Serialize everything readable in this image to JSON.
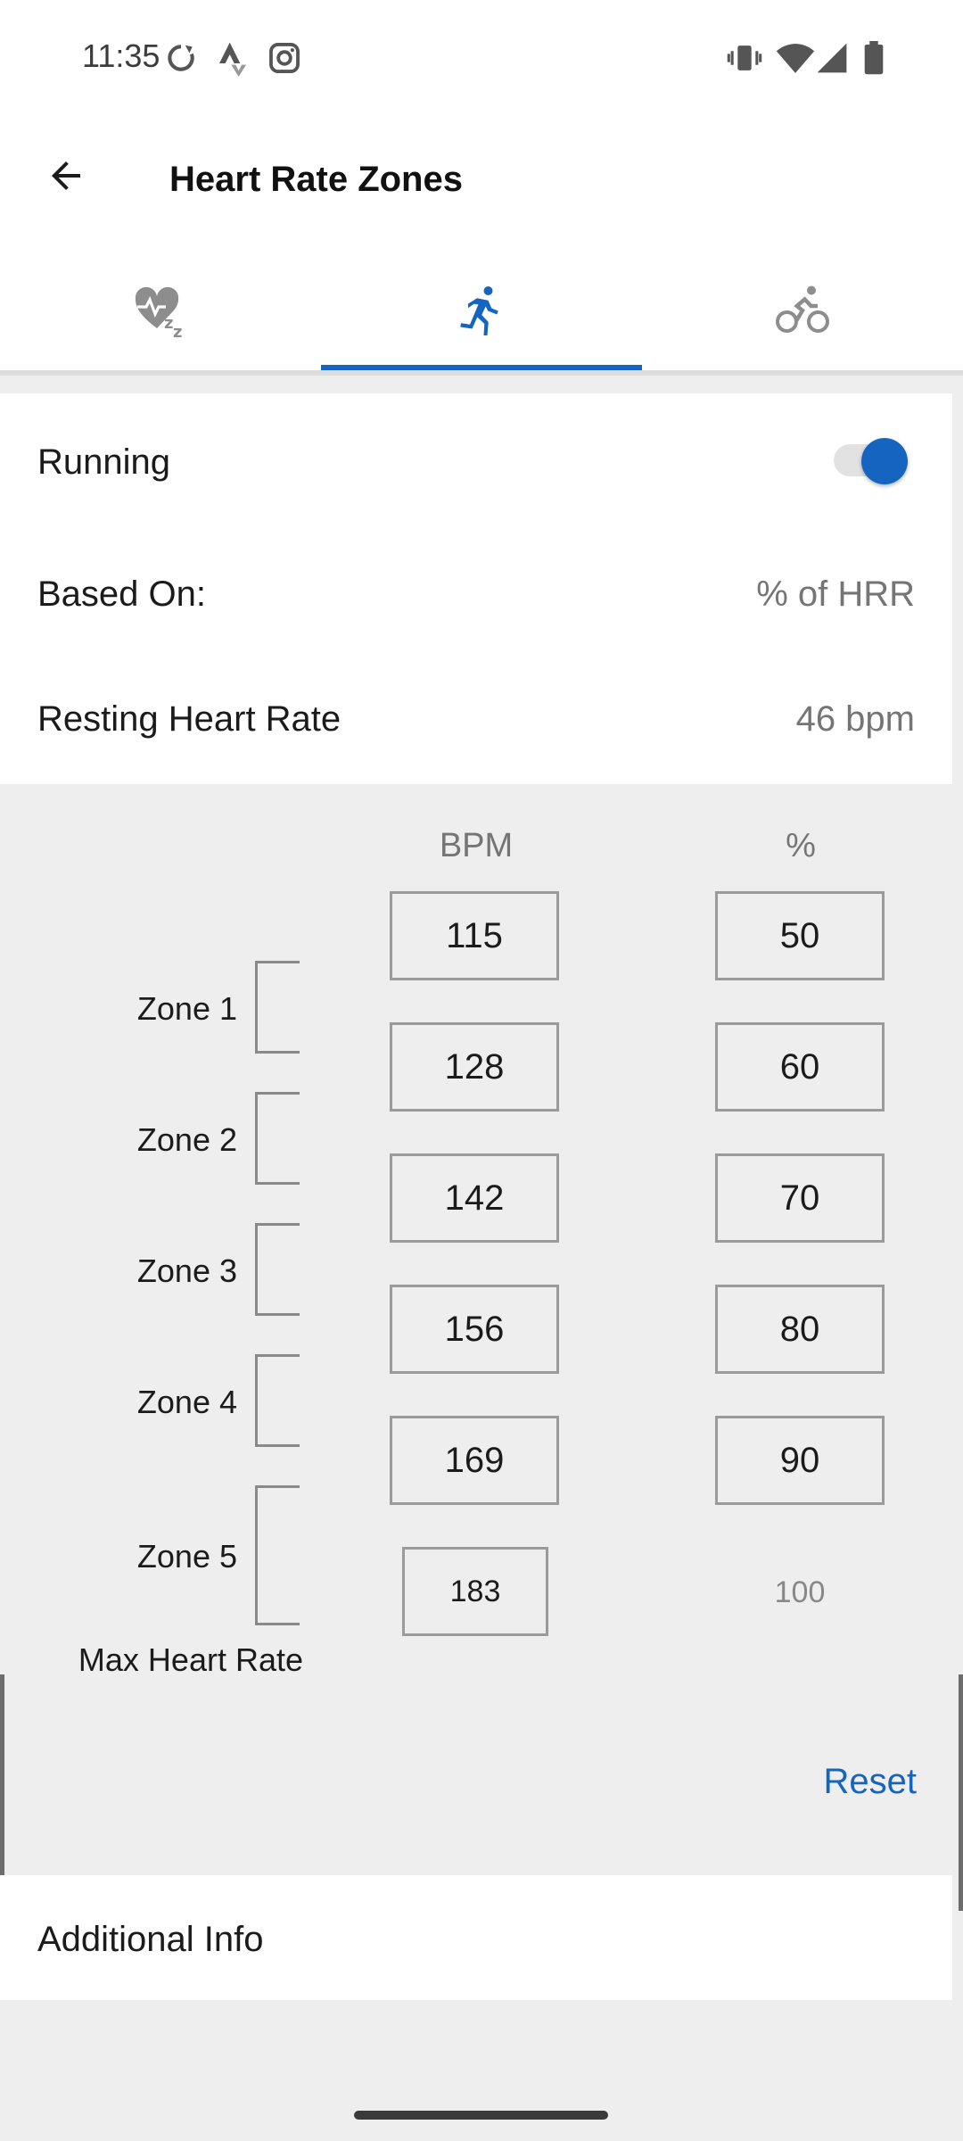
{
  "status_bar": {
    "time": "11:35",
    "left_icons": [
      "sync-icon",
      "strava-icon",
      "instagram-icon"
    ],
    "right_icons": [
      "vibrate-icon",
      "wifi-icon",
      "signal-icon",
      "battery-icon"
    ]
  },
  "app_bar": {
    "title": "Heart Rate Zones",
    "back_icon": "arrow-back-icon"
  },
  "tabs": [
    {
      "icon": "heart-sleep-icon",
      "selected": false
    },
    {
      "icon": "running-icon",
      "selected": true
    },
    {
      "icon": "cycling-icon",
      "selected": false
    }
  ],
  "settings": {
    "running_label": "Running",
    "running_enabled": true,
    "based_on_label": "Based On:",
    "based_on_value": "% of HRR",
    "resting_label": "Resting Heart Rate",
    "resting_value": "46 bpm"
  },
  "zones_table": {
    "bpm_header": "BPM",
    "pct_header": "%",
    "bpm_values": [
      "115",
      "128",
      "142",
      "156",
      "169",
      "183"
    ],
    "pct_values": [
      "50",
      "60",
      "70",
      "80",
      "90",
      "100"
    ],
    "zone_labels": [
      "Zone 1",
      "Zone 2",
      "Zone 3",
      "Zone 4",
      "Zone 5"
    ],
    "max_label": "Max Heart Rate"
  },
  "reset_label": "Reset",
  "additional_info_label": "Additional Info",
  "colors": {
    "accent": "#1565c0",
    "background": "#eeeeee",
    "card": "#ffffff"
  }
}
